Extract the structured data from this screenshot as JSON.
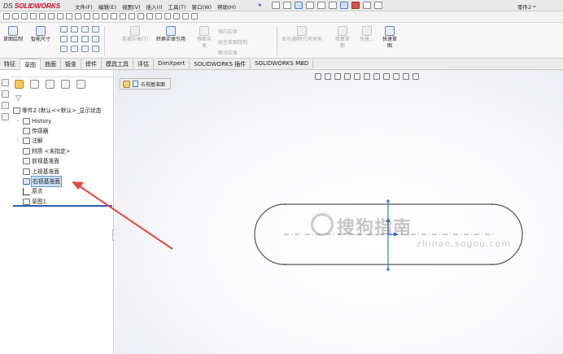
{
  "app": {
    "logo_prefix": "DS",
    "logo_text": "SOLIDWORKS",
    "doc_title": "零件2 *"
  },
  "menu": [
    "文件(F)",
    "编辑(E)",
    "视图(V)",
    "插入(I)",
    "工具(T)",
    "窗口(W)",
    "帮助(H)"
  ],
  "command_manager": {
    "sketch_draw": "草图绘制",
    "smart_dimension": "智能尺寸",
    "trim_entities": "剪裁实体(T)",
    "convert_entities": "转换实体引用",
    "offset_entities_1": "等距实",
    "offset_entities_2": "体",
    "mirror_entities": "镜向实体",
    "linear_pattern": "线性草图阵列",
    "move_entities": "移动实体",
    "display_relations": "显示/删除几何关系",
    "repair_sketch_1": "修复草",
    "repair_sketch_2": "图",
    "quick_snaps": "快速...",
    "rapid_sketch_1": "快速草",
    "rapid_sketch_2": "图"
  },
  "tabs": [
    {
      "label": "特征",
      "active": false
    },
    {
      "label": "草图",
      "active": true
    },
    {
      "label": "曲面",
      "active": false
    },
    {
      "label": "钣金",
      "active": false
    },
    {
      "label": "焊件",
      "active": false
    },
    {
      "label": "模具工具",
      "active": false
    },
    {
      "label": "评估",
      "active": false
    },
    {
      "label": "DimXpert",
      "active": false
    },
    {
      "label": "SOLIDWORKS 插件",
      "active": false
    },
    {
      "label": "SOLIDWORKS MBD",
      "active": false
    }
  ],
  "feature_tree": {
    "root": "零件2 (默认<<默认>_显示状态",
    "items": [
      {
        "label": "History",
        "expandable": true
      },
      {
        "label": "传感器",
        "expandable": false
      },
      {
        "label": "注解",
        "expandable": true
      },
      {
        "label": "材质 <未指定>",
        "expandable": false
      },
      {
        "label": "前视基准面",
        "expandable": false
      },
      {
        "label": "上视基准面",
        "expandable": false
      },
      {
        "label": "右视基准面",
        "expandable": false,
        "selected": true
      },
      {
        "label": "原点",
        "expandable": false
      },
      {
        "label": "草图1",
        "expandable": false
      }
    ]
  },
  "viewport": {
    "breadcrumb_label": "右视基准面"
  },
  "watermark": {
    "main": "搜狗指南",
    "sub": "zhinan.sogou.com"
  },
  "colors": {
    "brand_red": "#c8102e",
    "selection_blue": "#c7ddf5",
    "annotation_arrow": "#e8463c",
    "sketch_line": "#555555",
    "centerline_blue": "#3a7bd5"
  }
}
